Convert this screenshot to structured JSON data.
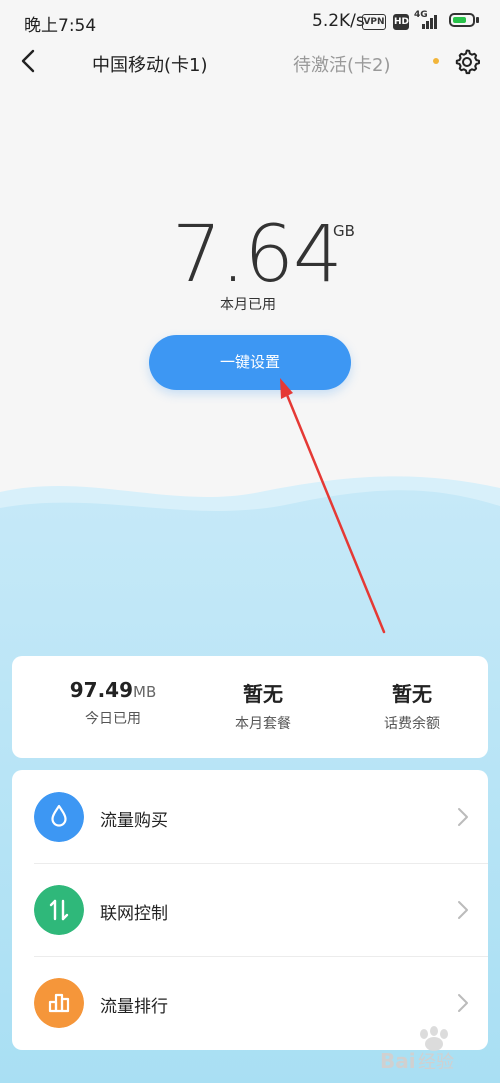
{
  "status": {
    "time": "晚上7:54",
    "speed": "5.2K/s",
    "vpn": "VPN",
    "hd": "HD",
    "network": "4G"
  },
  "tabs": {
    "sim1": "中国移动(卡1)",
    "sim2": "待激活(卡2)"
  },
  "usage": {
    "value": "7.64",
    "unit": "GB",
    "label": "本月已用"
  },
  "setup_button": "一键设置",
  "summary": [
    {
      "value": "97.49",
      "unit": "MB",
      "label": "今日已用"
    },
    {
      "value": "暂无",
      "unit": "",
      "label": "本月套餐"
    },
    {
      "value": "暂无",
      "unit": "",
      "label": "话费余额"
    }
  ],
  "menu": [
    {
      "label": "流量购买",
      "icon": "water-drop-icon",
      "color": "#3d97f3"
    },
    {
      "label": "联网控制",
      "icon": "up-down-arrows-icon",
      "color": "#2fb87a"
    },
    {
      "label": "流量排行",
      "icon": "bar-chart-icon",
      "color": "#f5963a"
    }
  ],
  "colors": {
    "accent": "#3d97f3",
    "annotation_arrow": "#e53935",
    "wave": "#bfe6f6",
    "notification_dot": "#f2b53a"
  },
  "watermark": "Bai经验"
}
